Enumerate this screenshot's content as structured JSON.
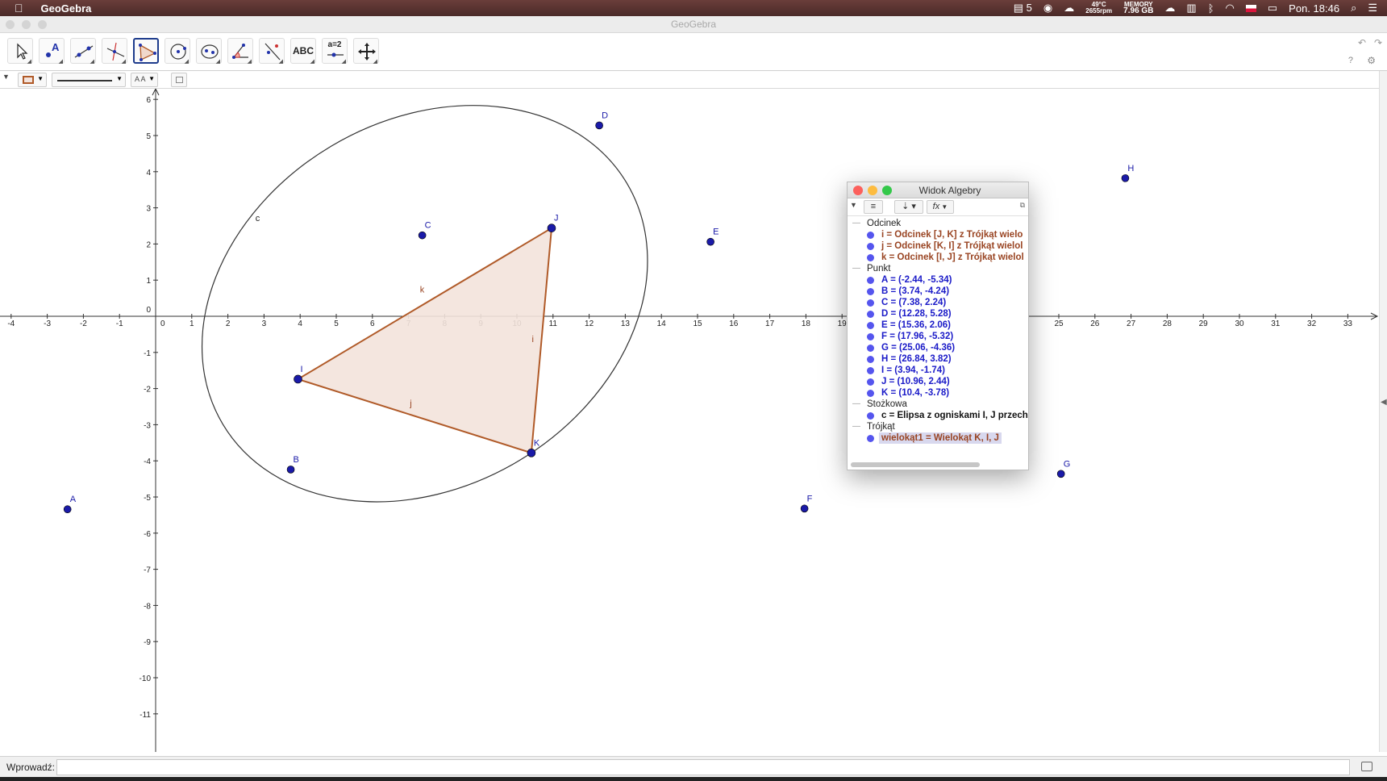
{
  "menubar": {
    "app_name": "GeoGebra",
    "indicator_count": "5",
    "temp": "49°C",
    "rpm": "2655rpm",
    "memory_label": "MEMORY",
    "memory_value": "7.96 GB",
    "datetime": "Pon. 18:46"
  },
  "window": {
    "title": "GeoGebra"
  },
  "toolbar": {
    "tools": [
      "move-tool",
      "point-tool",
      "line-tool",
      "perpendicular-tool",
      "polygon-tool",
      "circle-tool",
      "conic-tool",
      "angle-tool",
      "reflect-tool",
      "text-tool",
      "slider-tool",
      "move-view-tool"
    ],
    "text_tool_label": "ABC",
    "slider_tool_label": "a=2",
    "selected_tool": "polygon-tool"
  },
  "stylebar": {
    "font_label": "A A"
  },
  "graphics": {
    "x_ticks": [
      -4,
      -3,
      -2,
      -1,
      0,
      1,
      2,
      3,
      4,
      5,
      6,
      7,
      8,
      9,
      10,
      11,
      12,
      13,
      14,
      15,
      16,
      17,
      18,
      19,
      20,
      21,
      22,
      23,
      24,
      25,
      26,
      27,
      28,
      29,
      30,
      31,
      32,
      33
    ],
    "y_ticks": [
      6,
      5,
      4,
      3,
      2,
      1,
      0,
      -1,
      -2,
      -3,
      -4,
      -5,
      -6,
      -7,
      -8,
      -9,
      -10,
      -11
    ],
    "points": [
      {
        "name": "A",
        "x": -2.44,
        "y": -5.34
      },
      {
        "name": "B",
        "x": 3.74,
        "y": -4.24
      },
      {
        "name": "C",
        "x": 7.38,
        "y": 2.24
      },
      {
        "name": "D",
        "x": 12.28,
        "y": 5.28
      },
      {
        "name": "E",
        "x": 15.36,
        "y": 2.06
      },
      {
        "name": "F",
        "x": 17.96,
        "y": -5.32
      },
      {
        "name": "G",
        "x": 25.06,
        "y": -4.36
      },
      {
        "name": "H",
        "x": 26.84,
        "y": 3.82
      },
      {
        "name": "I",
        "x": 3.94,
        "y": -1.74
      },
      {
        "name": "J",
        "x": 10.96,
        "y": 2.44
      },
      {
        "name": "K",
        "x": 10.4,
        "y": -3.78
      }
    ],
    "segment_labels": {
      "i": "i",
      "j": "j",
      "k": "k"
    },
    "conic_label": "c",
    "colors": {
      "point": "#1a1aa8",
      "polygon_stroke": "#b05a28",
      "polygon_fill": "#f3e3dc",
      "segment_label": "#994422"
    }
  },
  "algebra": {
    "title": "Widok Algebry",
    "fx_label": "fx",
    "categories": [
      {
        "name": "Odcinek",
        "items": [
          "i = Odcinek [J, K] z Trójkąt wielo",
          "j = Odcinek [K, I] z Trójkąt wielol",
          "k = Odcinek [I, J] z Trójkąt wielol"
        ]
      },
      {
        "name": "Punkt",
        "items": [
          "A = (-2.44, -5.34)",
          "B = (3.74, -4.24)",
          "C = (7.38, 2.24)",
          "D = (12.28, 5.28)",
          "E = (15.36, 2.06)",
          "F = (17.96, -5.32)",
          "G = (25.06, -4.36)",
          "H = (26.84, 3.82)",
          "I = (3.94, -1.74)",
          "J = (10.96, 2.44)",
          "K = (10.4, -3.78)"
        ]
      },
      {
        "name": "Stożkowa",
        "items": [
          "c = Elipsa z ogniskami I, J przech"
        ]
      },
      {
        "name": "Trójkąt",
        "items": [
          "wielokąt1 = Wielokąt K, I, J"
        ]
      }
    ]
  },
  "input_bar": {
    "label": "Wprowadź:",
    "value": ""
  }
}
